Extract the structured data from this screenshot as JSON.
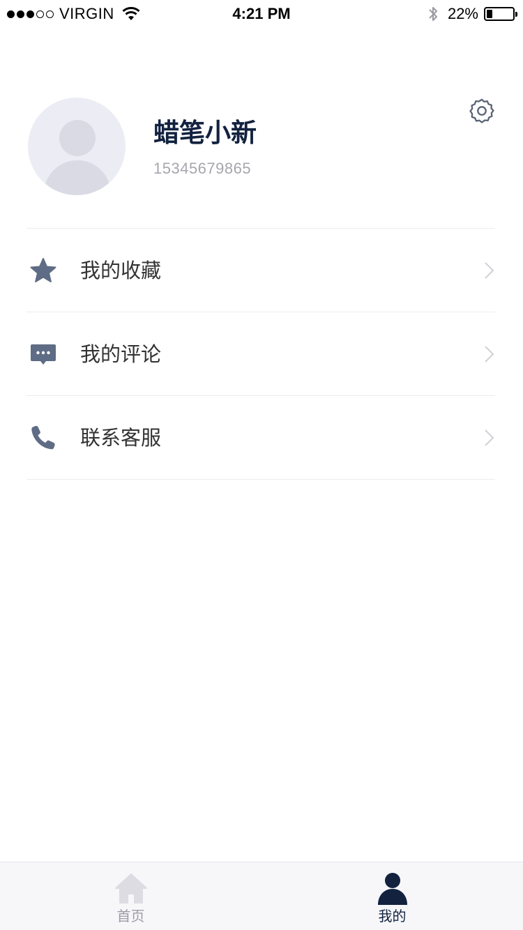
{
  "status_bar": {
    "carrier": "VIRGIN",
    "time": "4:21 PM",
    "battery_percent": "22%",
    "battery_level": 0.22,
    "signal_bars": 3,
    "signal_total": 5
  },
  "profile": {
    "name": "蜡笔小新",
    "phone": "15345679865"
  },
  "menu": {
    "items": [
      {
        "label": "我的收藏",
        "icon": "star-icon"
      },
      {
        "label": "我的评论",
        "icon": "comment-icon"
      },
      {
        "label": "联系客服",
        "icon": "phone-icon"
      }
    ]
  },
  "tabs": {
    "home": {
      "label": "首页",
      "icon": "home-icon"
    },
    "mine": {
      "label": "我的",
      "icon": "user-icon"
    }
  },
  "colors": {
    "brand_dark": "#12223f",
    "icon_gray": "#5f6c85",
    "inactive": "#9c9ca6"
  }
}
